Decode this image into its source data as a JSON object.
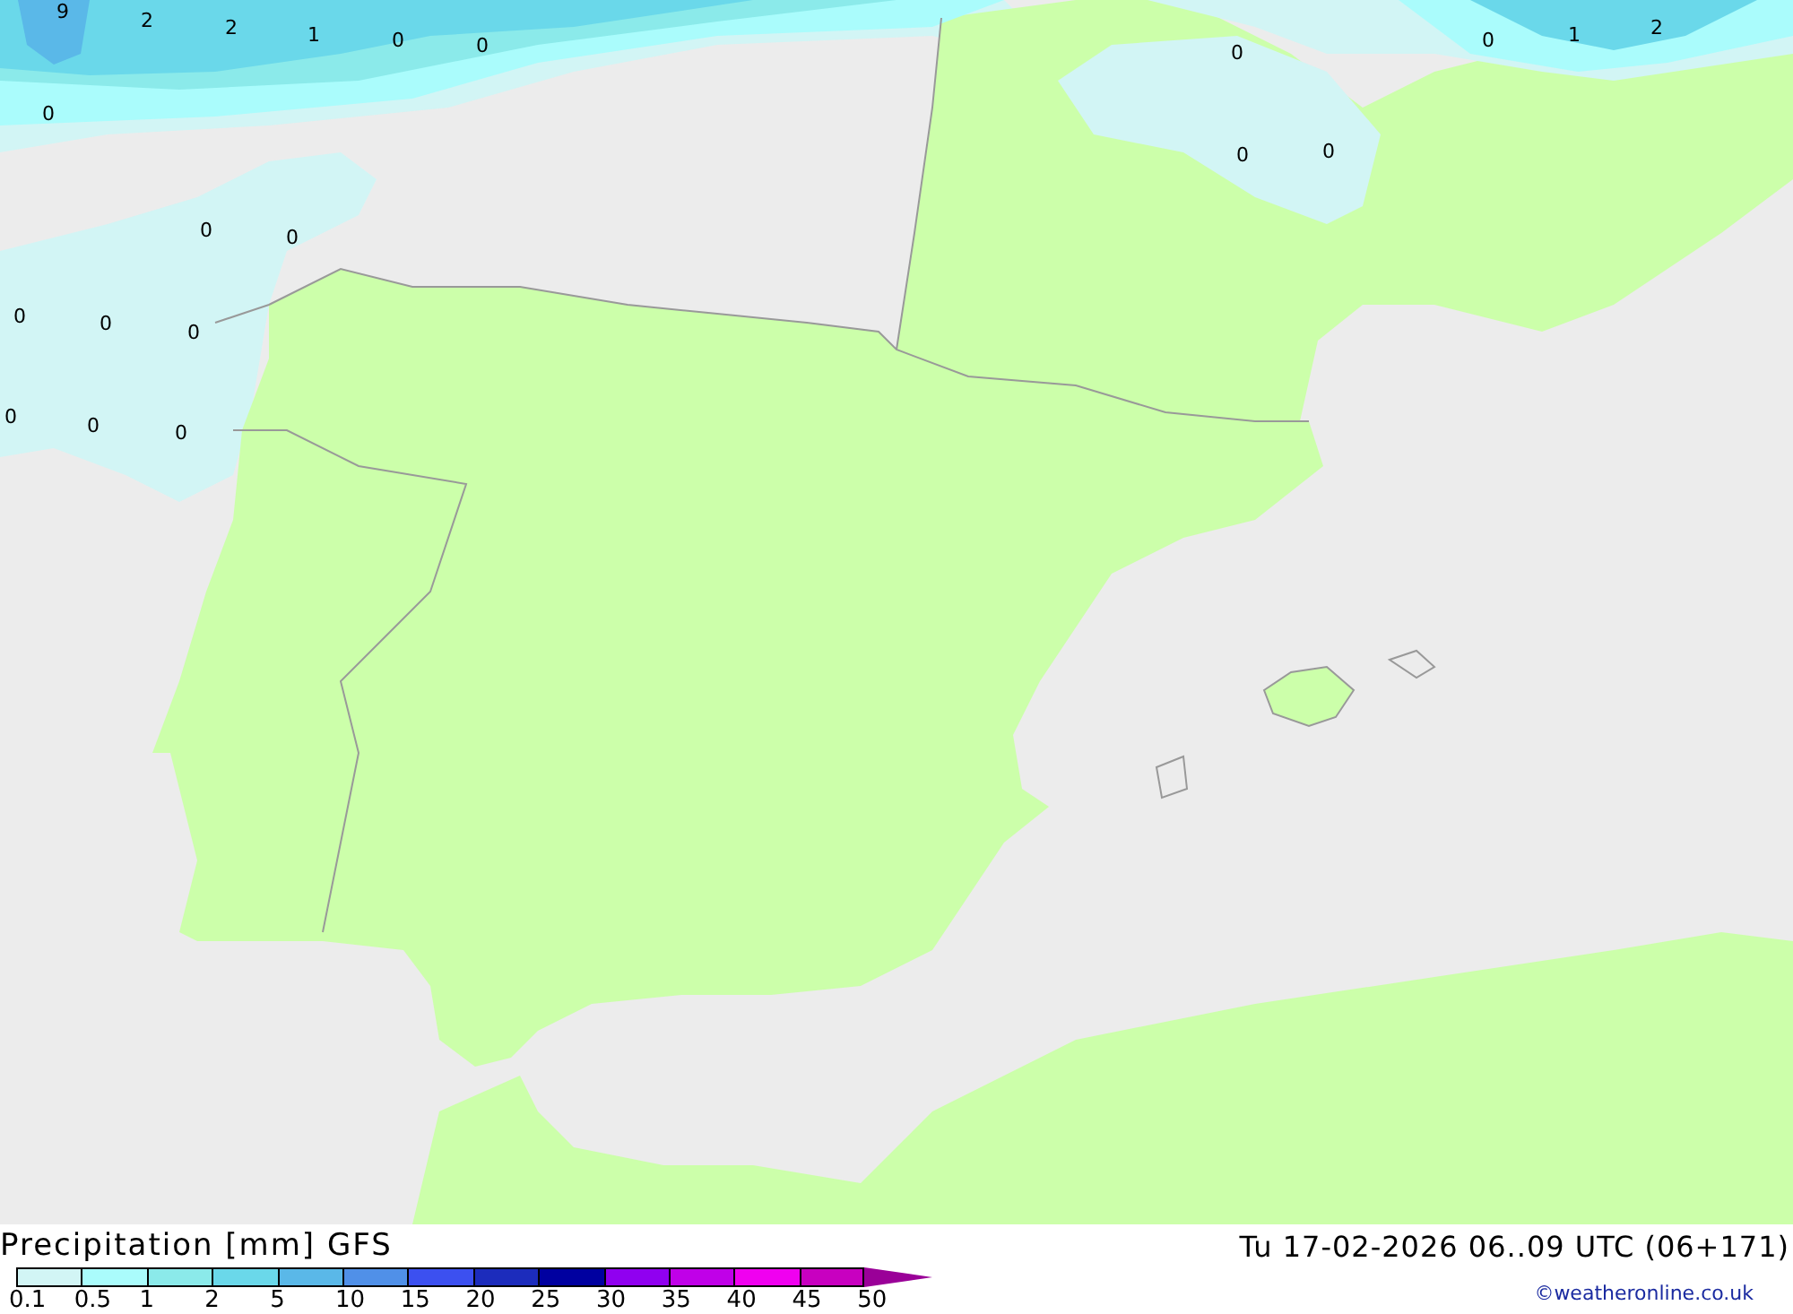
{
  "map": {
    "values": [
      "9",
      "2",
      "2",
      "1",
      "0",
      "0",
      "0",
      "0",
      "0",
      "0",
      "0",
      "0",
      "0",
      "0",
      "0",
      "0",
      "0",
      "1",
      "2",
      "0",
      "0"
    ]
  },
  "title": "Precipitation [mm] GFS",
  "valid_time": "Tu 17-02-2026 06..09 UTC (06+171)",
  "scale": [
    {
      "label": "0.1",
      "color": "#d2f5f5"
    },
    {
      "label": "0.5",
      "color": "#aafcfc"
    },
    {
      "label": "1",
      "color": "#8beaea"
    },
    {
      "label": "2",
      "color": "#6ad8ea"
    },
    {
      "label": "5",
      "color": "#5ab8e8"
    },
    {
      "label": "10",
      "color": "#5090e8"
    },
    {
      "label": "15",
      "color": "#3c50f0"
    },
    {
      "label": "20",
      "color": "#1c2cbc"
    },
    {
      "label": "25",
      "color": "#0000a0"
    },
    {
      "label": "30",
      "color": "#9000f0"
    },
    {
      "label": "35",
      "color": "#c000e8"
    },
    {
      "label": "40",
      "color": "#f000f0"
    },
    {
      "label": "45",
      "color": "#c800c0"
    },
    {
      "label": "50",
      "color": "#9a0098"
    }
  ],
  "copyright": "©weatheronline.co.uk"
}
